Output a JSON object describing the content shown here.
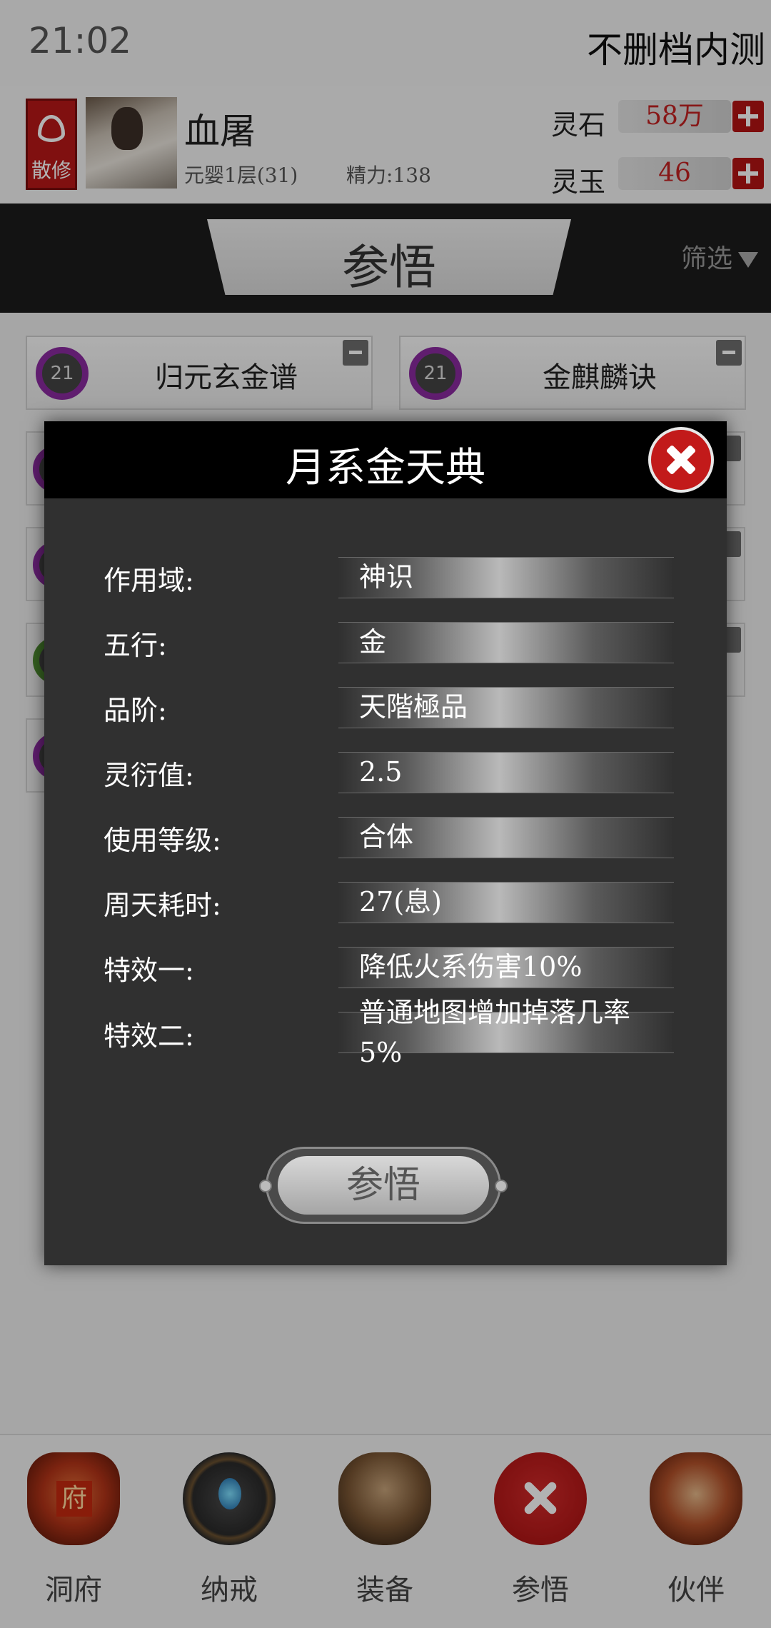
{
  "status_bar": {
    "time": "21:02",
    "note": "不删档内测"
  },
  "player": {
    "faction": "散修",
    "name": "血屠",
    "realm": "元婴1层(31)",
    "energy": "精力:138",
    "resources": [
      {
        "label": "灵石",
        "value": "58万"
      },
      {
        "label": "灵玉",
        "value": "46"
      }
    ]
  },
  "page": {
    "title": "参悟",
    "filter_label": "筛选"
  },
  "skills": [
    {
      "level": "21",
      "name": "归元玄金谱"
    },
    {
      "level": "21",
      "name": "金麒麟诀"
    }
  ],
  "modal": {
    "title": "月系金天典",
    "properties": [
      {
        "label": "作用域:",
        "value": "神识"
      },
      {
        "label": "五行:",
        "value": "金"
      },
      {
        "label": "品阶:",
        "value": "天階極品"
      },
      {
        "label": "灵衍值:",
        "value": "2.5"
      },
      {
        "label": "使用等级:",
        "value": "合体"
      },
      {
        "label": "周天耗时:",
        "value": "27(息)"
      },
      {
        "label": "特效一:",
        "value": "降低火系伤害10%"
      },
      {
        "label": "特效二:",
        "value": "普通地图增加掉落几率5%"
      }
    ],
    "action_label": "参悟"
  },
  "bottom_nav": [
    {
      "label": "洞府",
      "icon": "cave-mansion-icon"
    },
    {
      "label": "纳戒",
      "icon": "storage-ring-icon"
    },
    {
      "label": "装备",
      "icon": "equipment-icon"
    },
    {
      "label": "参悟",
      "icon": "close-x-icon"
    },
    {
      "label": "伙伴",
      "icon": "partner-icon"
    }
  ],
  "colors": {
    "accent_red": "#b31414",
    "modal_bg": "#303030",
    "modal_header": "#000000",
    "level_ring_purple": "#8a2aa0"
  }
}
